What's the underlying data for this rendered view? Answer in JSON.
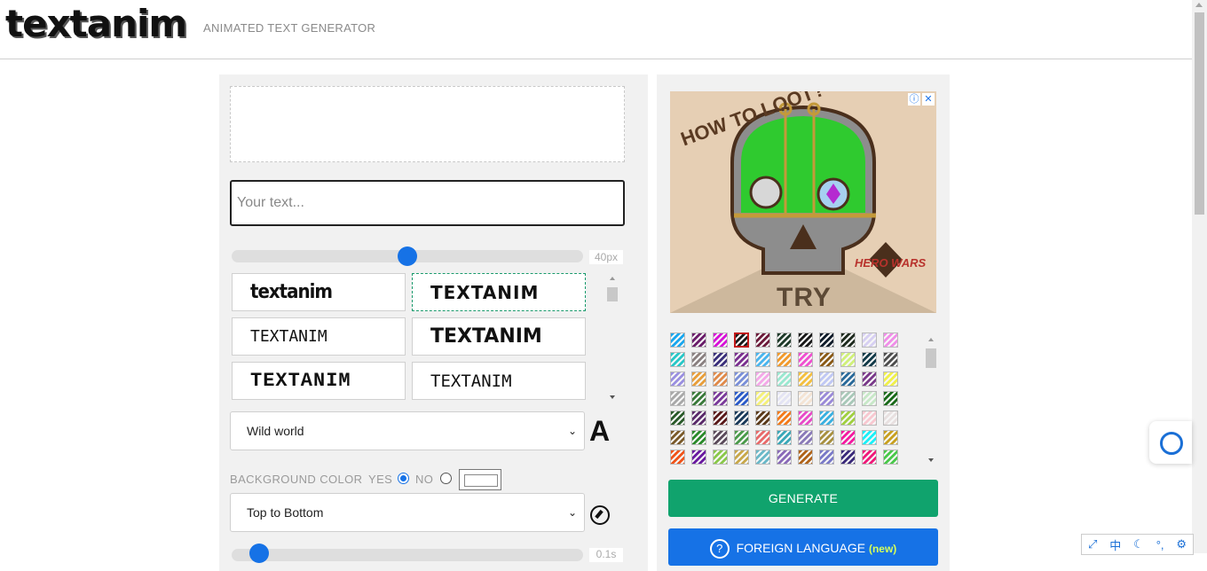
{
  "header": {
    "logo": "textanim",
    "tagline": "ANIMATED TEXT GENERATOR"
  },
  "editor": {
    "text_placeholder": "Your text...",
    "text_value": "",
    "size_label": "40px",
    "size_value": 40,
    "fonts": [
      {
        "label": "textanim"
      },
      {
        "label": "TEXTANIM"
      },
      {
        "label": "TEXTANIM"
      },
      {
        "label": "TEXTANIM"
      },
      {
        "label": "TEXTANIM"
      },
      {
        "label": "TEXTANIM"
      }
    ],
    "selected_font_index": 1,
    "font_select": "Wild world",
    "font_icon_label": "A",
    "background_color_label": "BACKGROUND COLOR",
    "yes_label": "YES",
    "no_label": "NO",
    "background_enabled": "YES",
    "direction_select": "Top to Bottom",
    "speed_label": "0.1s"
  },
  "ad": {
    "headline": "HOW TO LOOT?",
    "cta": "TRY",
    "brand": "HERO WARS",
    "info_icon": "info-icon",
    "close_icon": "close-icon"
  },
  "textures": {
    "colors": [
      "#19a7ee",
      "#6a1d6a",
      "#d711d7",
      "#1a1a1a",
      "#6d1a3a",
      "#1f3b2a",
      "#1a1a1a",
      "#101c2a",
      "#1e2a1e",
      "#d7d0f2",
      "#f08ee8",
      "#27c7c7",
      "#8a8080",
      "#3a2f7a",
      "#7a2f8f",
      "#4ab5ee",
      "#f29a2c",
      "#f04fd0",
      "#8a5a16",
      "#d0f07a",
      "#123a48",
      "#4d4d4d",
      "#9a8fe0",
      "#e89e3a",
      "#e08a4a",
      "#7a8fd8",
      "#f4a8e8",
      "#9ae8d0",
      "#f4c040",
      "#c0c8f4",
      "#2a6a9a",
      "#7a3a8a",
      "#f0f04a",
      "#a8a8a8",
      "#3a7a3a",
      "#7a3a9a",
      "#2a5ac8",
      "#f4f07a",
      "#e4e4f4",
      "#f4e4d4",
      "#9a8ad8",
      "#a8c8b8",
      "#c8e8c8",
      "#1a6a1a",
      "#2a5a2a",
      "#5a2a6a",
      "#5a1a1a",
      "#1a3a5a",
      "#5a3a1a",
      "#f47a1a",
      "#e84ac8",
      "#3ab0e0",
      "#a0d040",
      "#f8c8d0",
      "#e8e0e0",
      "#7a5a2a",
      "#2a8a2a",
      "#5a4a5a",
      "#4a9a4a",
      "#e86a6a",
      "#3aa8b8",
      "#8a7ab8",
      "#a89040",
      "#f41aa0",
      "#1af0f8",
      "#c8a020",
      "#f0541a",
      "#6a1aa0",
      "#8ac84a",
      "#c8a84a",
      "#6ab8c8",
      "#8a6ab8",
      "#b0641a",
      "#7a7ac8",
      "#3a2a7a",
      "#f01a7a",
      "#4ac84a"
    ],
    "selected_index": 3
  },
  "actions": {
    "generate_label": "GENERATE",
    "foreign_label": "FOREIGN LANGUAGE",
    "foreign_new": "(new)",
    "foreign_icon": "?"
  },
  "toolbar": {
    "items": [
      "⤢",
      "中",
      "☾",
      "°,",
      "⚙"
    ]
  }
}
